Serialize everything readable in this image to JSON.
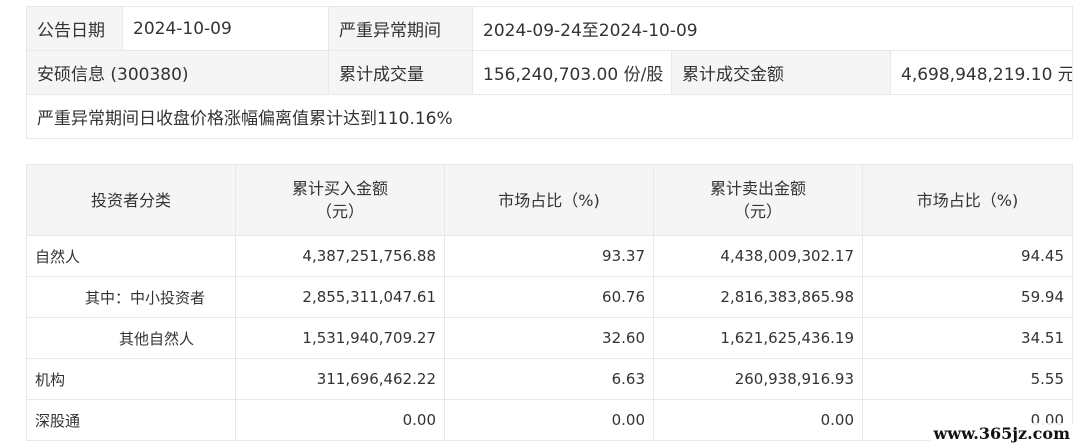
{
  "info": {
    "announce_date_label": "公告日期",
    "announce_date_value": "2024-10-09",
    "period_label": "严重异常期间",
    "period_value": "2024-09-24至2024-10-09",
    "stock_name": "安硕信息 (300380)",
    "volume_label": "累计成交量",
    "volume_value": "156,240,703.00 份/股",
    "amount_label": "累计成交金额",
    "amount_value": "4,698,948,219.10 元",
    "note": "严重异常期间日收盘价格涨幅偏离值累计达到110.16%"
  },
  "table": {
    "headers": {
      "category": "投资者分类",
      "buy_amount_line1": "累计买入金额",
      "buy_amount_line2": "（元）",
      "buy_share": "市场占比（%)",
      "sell_amount_line1": "累计卖出金额",
      "sell_amount_line2": "（元）",
      "sell_share": "市场占比（%)"
    },
    "rows": [
      {
        "category": "自然人",
        "buy": "4,387,251,756.88",
        "buy_pct": "93.37",
        "sell": "4,438,009,302.17",
        "sell_pct": "94.45"
      },
      {
        "category": "其中：中小投资者",
        "buy": "2,855,311,047.61",
        "buy_pct": "60.76",
        "sell": "2,816,383,865.98",
        "sell_pct": "59.94"
      },
      {
        "category": "其他自然人",
        "buy": "1,531,940,709.27",
        "buy_pct": "32.60",
        "sell": "1,621,625,436.19",
        "sell_pct": "34.51"
      },
      {
        "category": "机构",
        "buy": "311,696,462.22",
        "buy_pct": "6.63",
        "sell": "260,938,916.93",
        "sell_pct": "5.55"
      },
      {
        "category": "深股通",
        "buy": "0.00",
        "buy_pct": "0.00",
        "sell": "0.00",
        "sell_pct": "0.00"
      }
    ]
  },
  "watermark": "www.365jz.com"
}
